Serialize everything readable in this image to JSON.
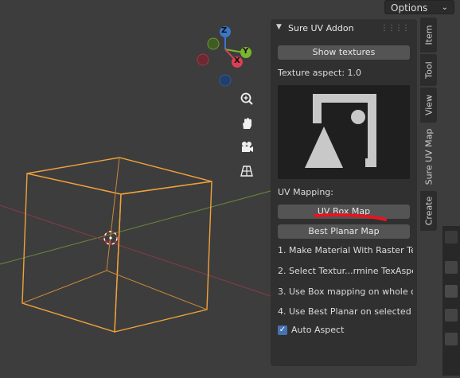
{
  "header": {
    "options_label": "Options",
    "chevron": "chevron-down-icon"
  },
  "navigation": {
    "gizmo_axes": {
      "z": "Z",
      "y": "Y",
      "x": "X"
    },
    "gizmo_colors": {
      "x": "#d84152",
      "y": "#7ab52f",
      "z": "#3b76c9"
    },
    "tools": [
      "zoom-icon",
      "hand-pan-icon",
      "camera-icon",
      "perspective-grid-icon"
    ]
  },
  "addon_panel": {
    "title": "Sure UV Addon",
    "show_textures_label": "Show textures",
    "texture_aspect_label": "Texture aspect: 1.0",
    "uv_mapping_label": "UV Mapping:",
    "uv_box_map_label": "UV Box Map",
    "best_planar_map_label": "Best Planar Map",
    "steps": [
      "1. Make Material With Raster Te...",
      "2. Select Textur...rmine TexAspec",
      "3. Use Box mapping on whole o...",
      "4. Use Best Planar on selected f..."
    ],
    "auto_aspect_label": "Auto Aspect",
    "auto_aspect_checked": true,
    "annotation_color": "#e8141e"
  },
  "sidebar_tabs": [
    {
      "label": "Item",
      "active": false
    },
    {
      "label": "Tool",
      "active": false
    },
    {
      "label": "View",
      "active": false
    },
    {
      "label": "Sure UV Map",
      "active": true
    },
    {
      "label": "Create",
      "active": false
    }
  ]
}
